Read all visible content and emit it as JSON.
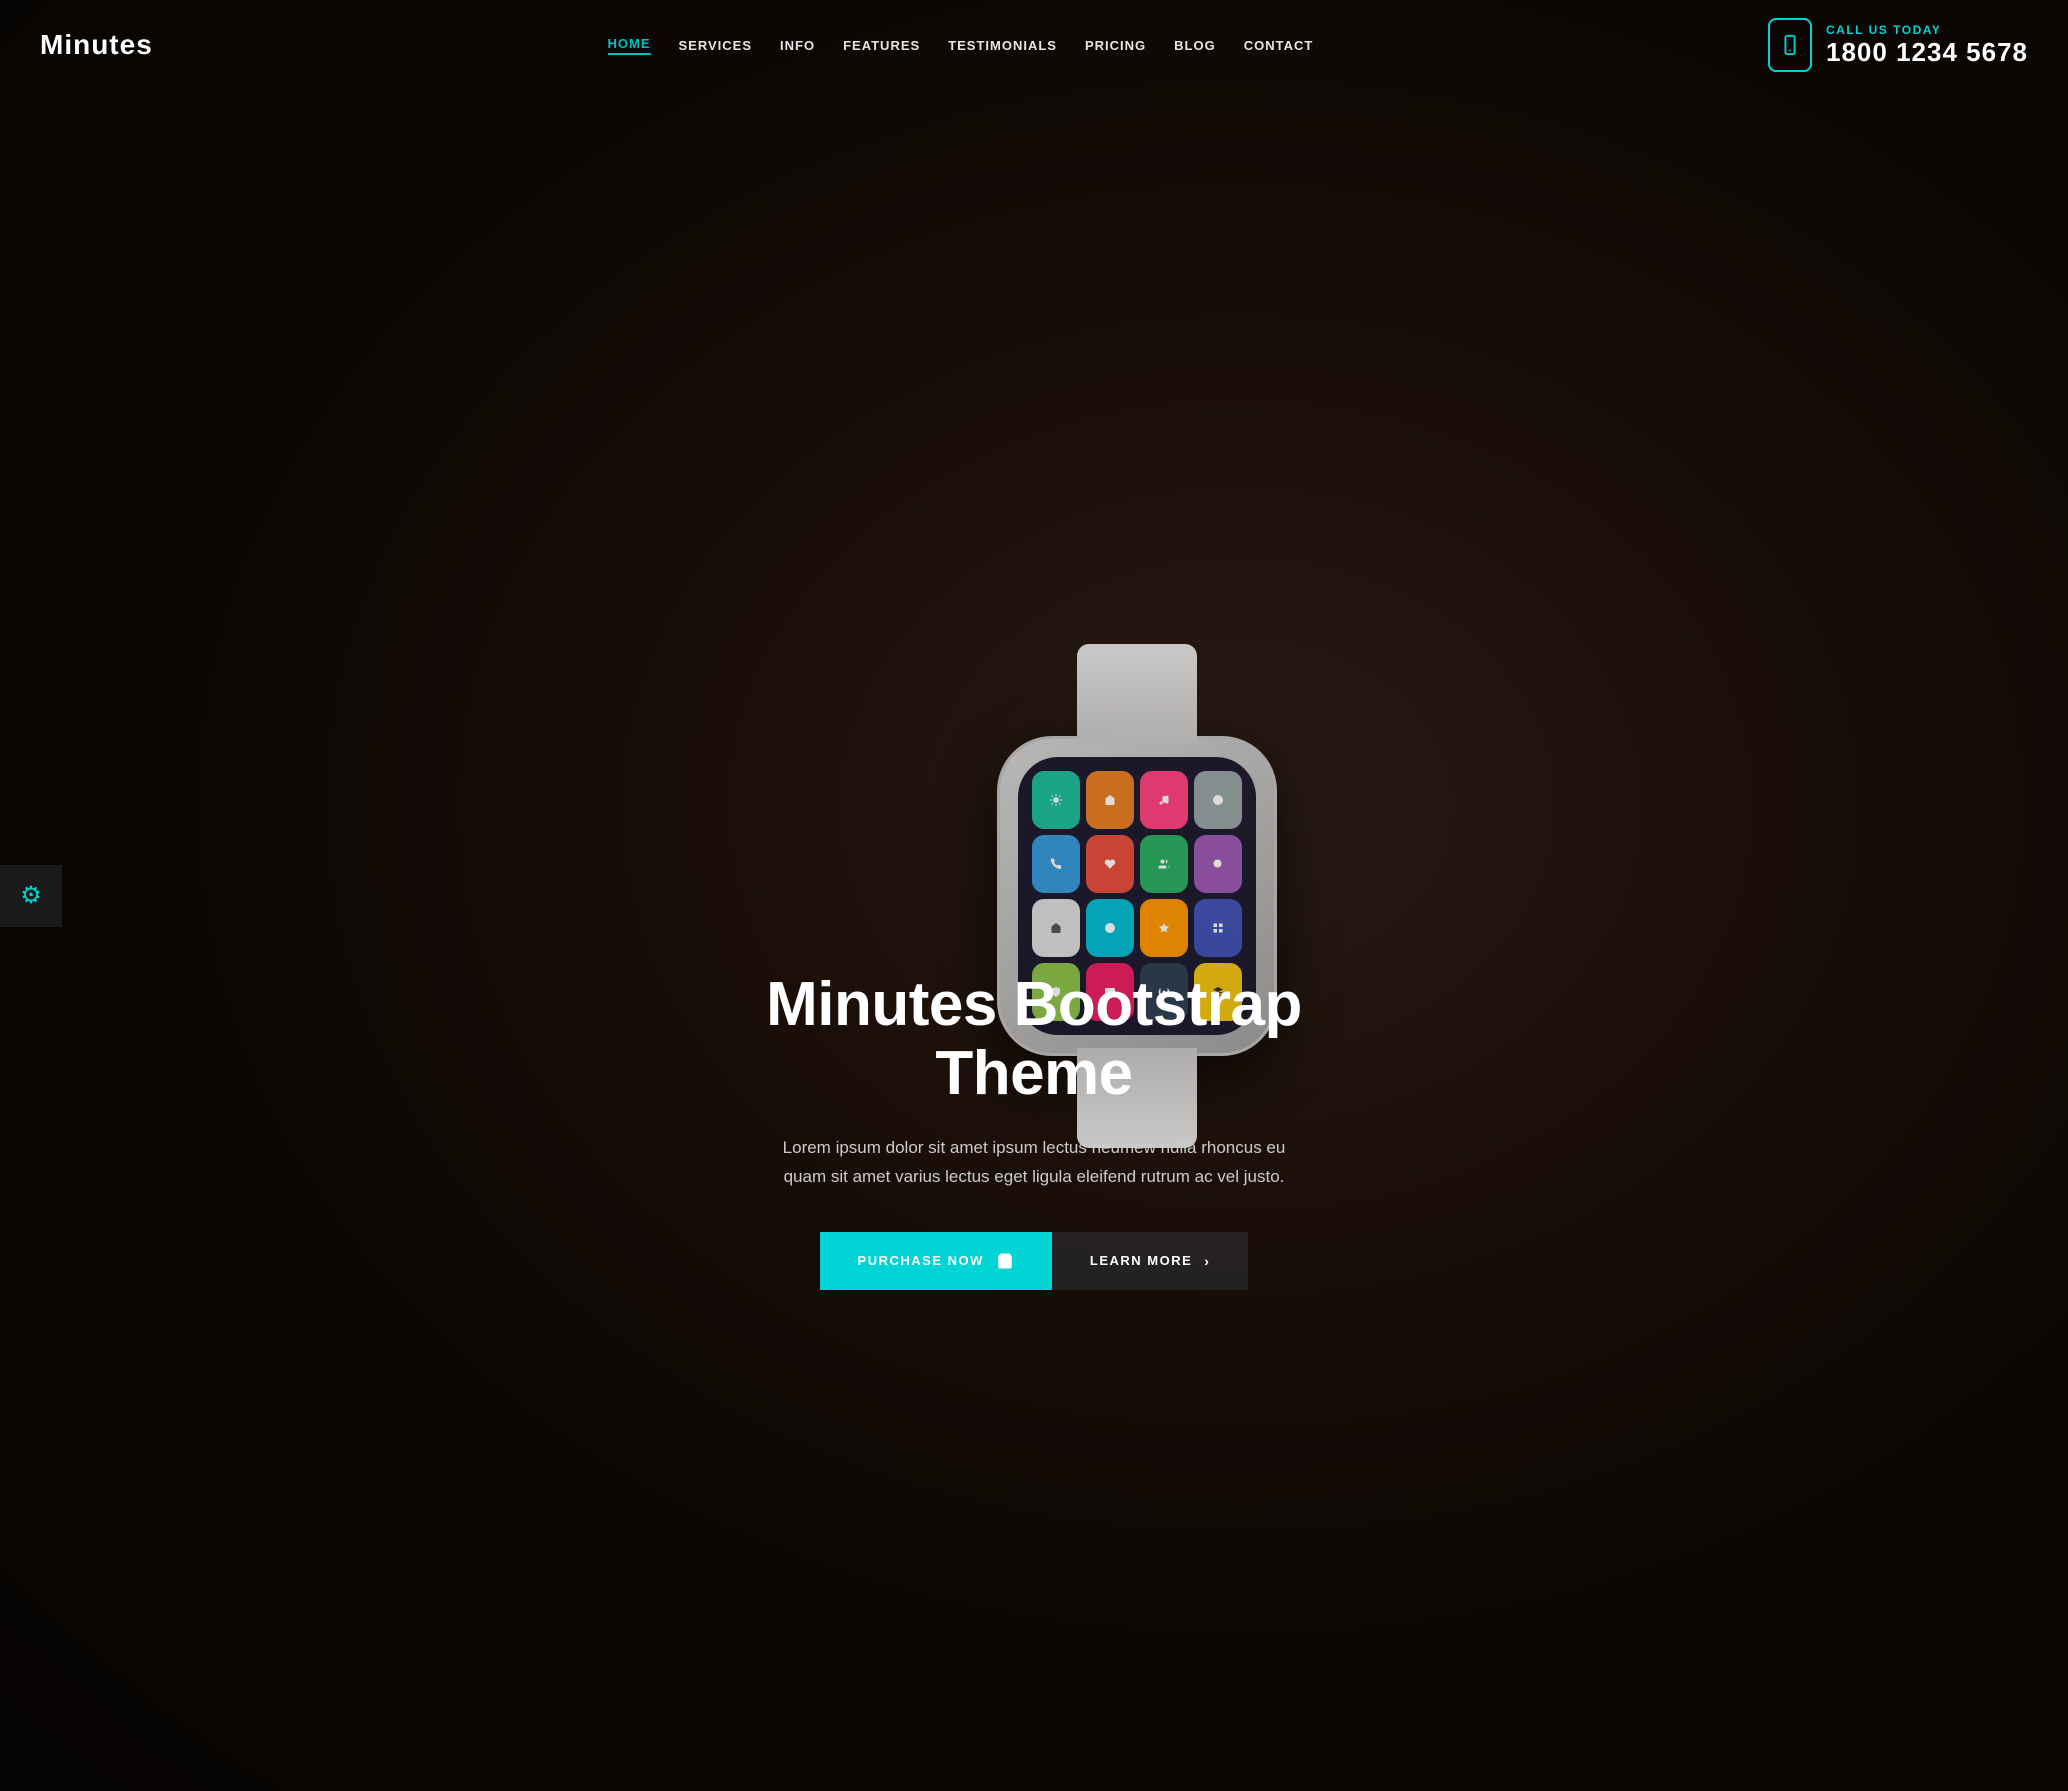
{
  "site": {
    "logo": "Minutes",
    "accent_color": "#00d4d4",
    "background_color": "#1a1a1a"
  },
  "header": {
    "nav_items": [
      {
        "label": "HOME",
        "active": true
      },
      {
        "label": "SERVICES",
        "active": false
      },
      {
        "label": "INFO",
        "active": false
      },
      {
        "label": "FEATURES",
        "active": false
      },
      {
        "label": "TESTIMONIALS",
        "active": false
      },
      {
        "label": "PRICING",
        "active": false
      },
      {
        "label": "BLOG",
        "active": false
      },
      {
        "label": "CONTACT",
        "active": false
      }
    ],
    "call_label": "CALL US TODAY",
    "phone": "1800 1234 5678"
  },
  "hero": {
    "title": "Minutes Bootstrap Theme",
    "subtitle": "Lorem ipsum dolor sit amet ipsum lectus neumew nulla rhoncus eu quam sit amet varius lectus eget ligula eleifend rutrum ac vel justo.",
    "btn_purchase": "PURCHASE NOW",
    "btn_learn": "LEARN MORE"
  },
  "settings": {
    "icon": "⚙"
  },
  "watch": {
    "app_icons": [
      {
        "color": "icon-teal",
        "symbol": ""
      },
      {
        "color": "icon-orange",
        "symbol": ""
      },
      {
        "color": "icon-rose",
        "symbol": ""
      },
      {
        "color": "icon-gray",
        "symbol": ""
      },
      {
        "color": "icon-blue",
        "symbol": ""
      },
      {
        "color": "icon-red",
        "symbol": ""
      },
      {
        "color": "icon-green",
        "symbol": ""
      },
      {
        "color": "icon-purple",
        "symbol": ""
      },
      {
        "color": "icon-white",
        "symbol": ""
      },
      {
        "color": "icon-cyan",
        "symbol": ""
      },
      {
        "color": "icon-amber",
        "symbol": ""
      },
      {
        "color": "icon-indigo",
        "symbol": ""
      },
      {
        "color": "icon-lime",
        "symbol": ""
      },
      {
        "color": "icon-pink",
        "symbol": ""
      },
      {
        "color": "icon-dark",
        "symbol": ""
      },
      {
        "color": "icon-yellow",
        "symbol": ""
      }
    ]
  }
}
